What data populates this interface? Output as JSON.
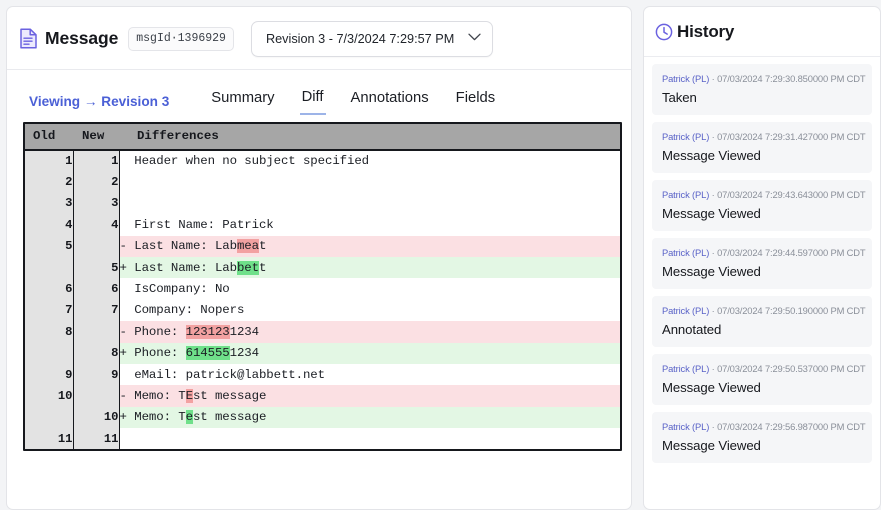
{
  "message": {
    "icon": "document-icon",
    "title": "Message",
    "msg_id_badge": "msgId·1396929",
    "revision_select": {
      "value": "Revision 3 - 7/3/2024 7:29:57 PM",
      "chevron": "chevron-down-icon"
    }
  },
  "nav": {
    "viewing_label": "Viewing → Revision 3",
    "tabs": [
      {
        "label": "Summary",
        "active": false
      },
      {
        "label": "Diff",
        "active": true
      },
      {
        "label": "Annotations",
        "active": false
      },
      {
        "label": "Fields",
        "active": false
      }
    ]
  },
  "diff": {
    "columns": {
      "old": "Old",
      "new": "New",
      "differences": "Differences"
    },
    "rows": [
      {
        "old": "1",
        "new": "1",
        "type": "ctx",
        "sign": " ",
        "pre": " Header when no subject specified",
        "mark": "",
        "post": ""
      },
      {
        "old": "2",
        "new": "2",
        "type": "ctx",
        "sign": " ",
        "pre": "",
        "mark": "",
        "post": ""
      },
      {
        "old": "3",
        "new": "3",
        "type": "ctx",
        "sign": " ",
        "pre": "",
        "mark": "",
        "post": ""
      },
      {
        "old": "4",
        "new": "4",
        "type": "ctx",
        "sign": " ",
        "pre": " First Name: Patrick",
        "mark": "",
        "post": ""
      },
      {
        "old": "5",
        "new": "",
        "type": "del",
        "sign": "-",
        "pre": " Last Name: Lab",
        "mark": "mea",
        "post": "t"
      },
      {
        "old": "",
        "new": "5",
        "type": "add",
        "sign": "+",
        "pre": " Last Name: Lab",
        "mark": "bet",
        "post": "t"
      },
      {
        "old": "6",
        "new": "6",
        "type": "ctx",
        "sign": " ",
        "pre": " IsCompany: No",
        "mark": "",
        "post": ""
      },
      {
        "old": "7",
        "new": "7",
        "type": "ctx",
        "sign": " ",
        "pre": " Company: Nopers",
        "mark": "",
        "post": ""
      },
      {
        "old": "8",
        "new": "",
        "type": "del",
        "sign": "-",
        "pre": " Phone: ",
        "mark": "123123",
        "post": "1234"
      },
      {
        "old": "",
        "new": "8",
        "type": "add",
        "sign": "+",
        "pre": " Phone: ",
        "mark": "614555",
        "post": "1234"
      },
      {
        "old": "9",
        "new": "9",
        "type": "ctx",
        "sign": " ",
        "pre": " eMail: patrick@labbett.net",
        "mark": "",
        "post": ""
      },
      {
        "old": "10",
        "new": "",
        "type": "del",
        "sign": "-",
        "pre": " Memo: T",
        "mark": "E",
        "post": "st message"
      },
      {
        "old": "",
        "new": "10",
        "type": "add",
        "sign": "+",
        "pre": " Memo: T",
        "mark": "e",
        "post": "st message"
      },
      {
        "old": "11",
        "new": "11",
        "type": "ctx",
        "sign": " ",
        "pre": "",
        "mark": "",
        "post": ""
      }
    ]
  },
  "history": {
    "icon": "clock-icon",
    "title": "History",
    "items": [
      {
        "user": "Patrick (PL)",
        "sep": " · ",
        "timestamp": "07/03/2024 7:29:30.850000 PM CDT",
        "action": "Taken"
      },
      {
        "user": "Patrick (PL)",
        "sep": " · ",
        "timestamp": "07/03/2024 7:29:31.427000 PM CDT",
        "action": "Message Viewed"
      },
      {
        "user": "Patrick (PL)",
        "sep": " · ",
        "timestamp": "07/03/2024 7:29:43.643000 PM CDT",
        "action": "Message Viewed"
      },
      {
        "user": "Patrick (PL)",
        "sep": " · ",
        "timestamp": "07/03/2024 7:29:44.597000 PM CDT",
        "action": "Message Viewed"
      },
      {
        "user": "Patrick (PL)",
        "sep": " · ",
        "timestamp": "07/03/2024 7:29:50.190000 PM CDT",
        "action": "Annotated"
      },
      {
        "user": "Patrick (PL)",
        "sep": " · ",
        "timestamp": "07/03/2024 7:29:50.537000 PM CDT",
        "action": "Message Viewed"
      },
      {
        "user": "Patrick (PL)",
        "sep": " · ",
        "timestamp": "07/03/2024 7:29:56.987000 PM CDT",
        "action": "Message Viewed"
      }
    ]
  },
  "colors": {
    "accent": "#4b60d6",
    "icon_purple": "#6b62e0",
    "del_row": "#fbe0e3",
    "add_row": "#e3f7e4",
    "del_mark": "#f2a1a1",
    "add_mark": "#6fe08a",
    "header_gray": "#a6a6a6",
    "gutter_gray": "#e3e3e3"
  }
}
